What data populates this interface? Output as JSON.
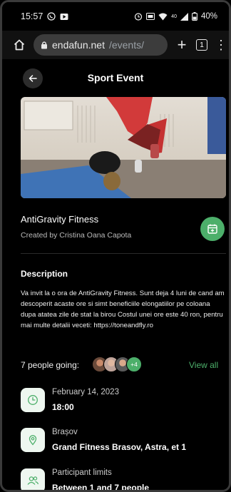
{
  "status": {
    "time": "15:57",
    "battery": "40%",
    "signal": "40"
  },
  "browser": {
    "domain": "endafun.net",
    "path": "/events/",
    "tab_count": "1"
  },
  "header": {
    "title": "Sport Event"
  },
  "event": {
    "title": "AntiGravity Fitness",
    "creator": "Created by Cristina Oana Capota"
  },
  "description": {
    "heading": "Description",
    "text": "Va invit la o ora de AntiGravity Fitness. Sunt deja 4 luni de cand am descoperit acaste ore si simt beneficiile elongatiilor pe coloana dupa atatea zile de stat la birou Costul unei ore este 40 ron, pentru mai multe detalii veceti: https://toneandfly.ro"
  },
  "attendance": {
    "going_label": "7 people going:",
    "more": "+4",
    "view_all": "View all"
  },
  "details": {
    "date": {
      "label": "February 14, 2023",
      "value": "18:00"
    },
    "location": {
      "label": "Brașov",
      "value": "Grand Fitness Brasov, Astra, et 1"
    },
    "limits": {
      "label": "Participant limits",
      "value": "Between 1 and 7 people"
    }
  },
  "colors": {
    "accent": "#4caf6a",
    "background": "#000000"
  }
}
